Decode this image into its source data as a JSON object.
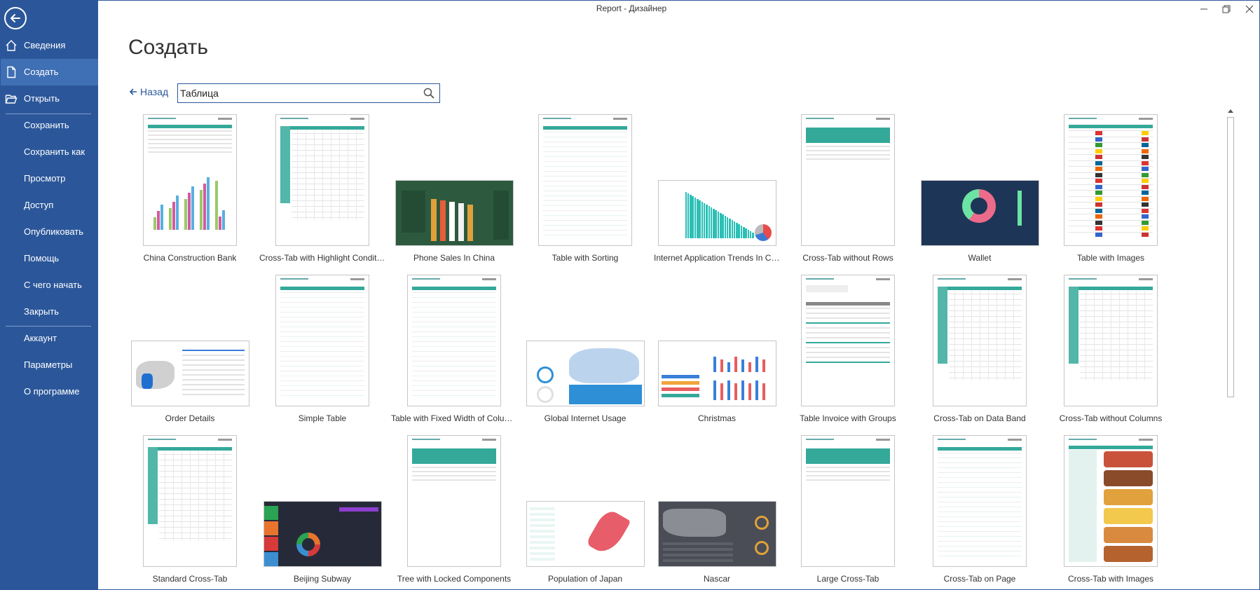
{
  "window": {
    "title": "Report - Дизайнер"
  },
  "sidebar": {
    "items": [
      {
        "label": "Сведения",
        "icon": "home-icon"
      },
      {
        "label": "Создать",
        "icon": "new-document-icon",
        "active": true
      },
      {
        "label": "Открыть",
        "icon": "folder-open-icon"
      },
      {
        "label": "Сохранить"
      },
      {
        "label": "Сохранить как"
      },
      {
        "label": "Просмотр"
      },
      {
        "label": "Доступ"
      },
      {
        "label": "Опубликовать"
      },
      {
        "label": "Помощь"
      },
      {
        "label": "С чего начать"
      },
      {
        "label": "Закрыть"
      },
      {
        "label": "Аккаунт"
      },
      {
        "label": "Параметры"
      },
      {
        "label": "О программе"
      }
    ]
  },
  "header": {
    "title": "Создать",
    "back_label": "Назад",
    "search_value": "Таблица"
  },
  "colors": {
    "accent": "#2b579a",
    "teal": "#34a99a",
    "dark_navy": "#1d3557"
  },
  "templates": [
    {
      "label": "China Construction Bank",
      "style": "portrait-chart"
    },
    {
      "label": "Cross-Tab with Highlight Conditio...",
      "style": "portrait-grid"
    },
    {
      "label": "Phone Sales In China",
      "style": "landscape-green"
    },
    {
      "label": "Table with Sorting",
      "style": "portrait-table"
    },
    {
      "label": "Internet Application Trends In Chi...",
      "style": "landscape-teal-bars"
    },
    {
      "label": "Cross-Tab without Rows",
      "style": "portrait-top"
    },
    {
      "label": "Wallet",
      "style": "landscape-wallet"
    },
    {
      "label": "Table with Images",
      "style": "portrait-flags"
    },
    {
      "label": "Order Details",
      "style": "landscape-map"
    },
    {
      "label": "Simple Table",
      "style": "portrait-table"
    },
    {
      "label": "Table with Fixed Width of Columns",
      "style": "portrait-table"
    },
    {
      "label": "Global Internet Usage",
      "style": "landscape-world"
    },
    {
      "label": "Christmas",
      "style": "landscape-christmas"
    },
    {
      "label": "Table Invoice with Groups",
      "style": "portrait-invoice"
    },
    {
      "label": "Cross-Tab on Data Band",
      "style": "portrait-grid"
    },
    {
      "label": "Cross-Tab without Columns",
      "style": "portrait-grid"
    },
    {
      "label": "Standard Cross-Tab",
      "style": "portrait-grid"
    },
    {
      "label": "Beijing Subway",
      "style": "landscape-subway"
    },
    {
      "label": "Tree with Locked Components",
      "style": "portrait-top"
    },
    {
      "label": "Population of Japan",
      "style": "landscape-japan"
    },
    {
      "label": "Nascar",
      "style": "landscape-nascar"
    },
    {
      "label": "Large Cross-Tab",
      "style": "portrait-top"
    },
    {
      "label": "Cross-Tab on Page",
      "style": "portrait-table"
    },
    {
      "label": "Cross-Tab with Images",
      "style": "portrait-food"
    }
  ]
}
